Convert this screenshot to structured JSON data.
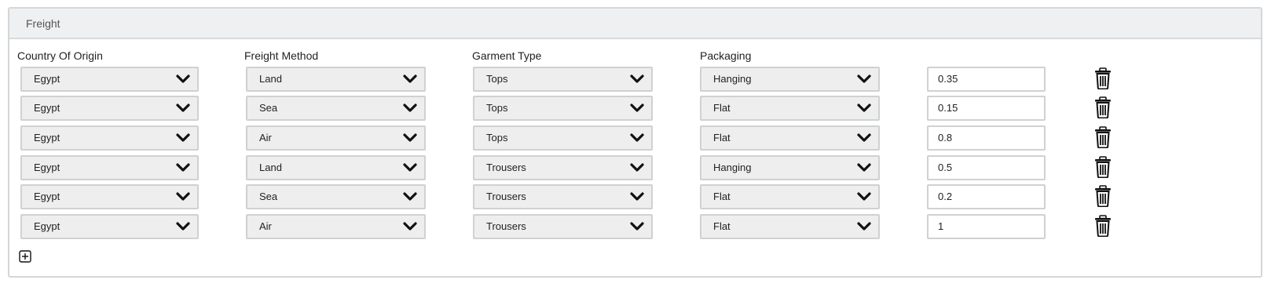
{
  "panel": {
    "title": "Freight"
  },
  "columns": {
    "country": "Country Of Origin",
    "method": "Freight Method",
    "garment": "Garment Type",
    "packaging": "Packaging"
  },
  "rows": [
    {
      "country": "Egypt",
      "method": "Land",
      "garment": "Tops",
      "packaging": "Hanging",
      "value": "0.35"
    },
    {
      "country": "Egypt",
      "method": "Sea",
      "garment": "Tops",
      "packaging": "Flat",
      "value": "0.15"
    },
    {
      "country": "Egypt",
      "method": "Air",
      "garment": "Tops",
      "packaging": "Flat",
      "value": "0.8"
    },
    {
      "country": "Egypt",
      "method": "Land",
      "garment": "Trousers",
      "packaging": "Hanging",
      "value": "0.5"
    },
    {
      "country": "Egypt",
      "method": "Sea",
      "garment": "Trousers",
      "packaging": "Flat",
      "value": "0.2"
    },
    {
      "country": "Egypt",
      "method": "Air",
      "garment": "Trousers",
      "packaging": "Flat",
      "value": "1"
    }
  ],
  "icons": {
    "dropdown": "chevron-down-icon",
    "delete": "trash-icon",
    "add": "plus-square-icon"
  }
}
